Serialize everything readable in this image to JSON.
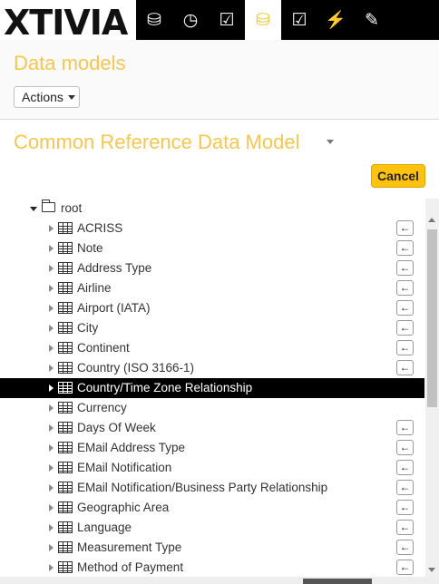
{
  "brand": {
    "logo_text": "XTIVIA"
  },
  "nav": {
    "icons": [
      "database-icon",
      "clock-icon",
      "checkbox-icon",
      "database-edit-icon",
      "checklist-edit-icon",
      "plug-icon",
      "wrench-icon"
    ],
    "glyphs": [
      "⛁",
      "◷",
      "☑",
      "⛁",
      "☑",
      "⚡",
      "✎"
    ],
    "active_index": 3
  },
  "header": {
    "title": "Data models",
    "actions_label": "Actions"
  },
  "model": {
    "title": "Common Reference Data Model",
    "cancel_label": "Cancel"
  },
  "tree": {
    "root_label": "root",
    "items": [
      {
        "label": "ACRISS",
        "arrow": true
      },
      {
        "label": "Note",
        "arrow": true
      },
      {
        "label": "Address Type",
        "arrow": true
      },
      {
        "label": "Airline",
        "arrow": true
      },
      {
        "label": "Airport (IATA)",
        "arrow": true
      },
      {
        "label": "City",
        "arrow": true
      },
      {
        "label": "Continent",
        "arrow": true
      },
      {
        "label": "Country (ISO 3166-1)",
        "arrow": true
      },
      {
        "label": "Country/Time Zone Relationship",
        "arrow": false,
        "selected": true
      },
      {
        "label": "Currency",
        "arrow": false
      },
      {
        "label": "Days Of Week",
        "arrow": true
      },
      {
        "label": "EMail Address Type",
        "arrow": true
      },
      {
        "label": "EMail Notification",
        "arrow": true
      },
      {
        "label": "EMail Notification/Business Party Relationship",
        "arrow": true
      },
      {
        "label": "Geographic Area",
        "arrow": true
      },
      {
        "label": "Language",
        "arrow": true
      },
      {
        "label": "Measurement Type",
        "arrow": true
      },
      {
        "label": "Method of Payment",
        "arrow": true
      }
    ],
    "arrow_glyph": "←"
  },
  "colors": {
    "accent": "#f6c64f",
    "cancel": "#ffc20e",
    "nav_bg": "#000000"
  }
}
